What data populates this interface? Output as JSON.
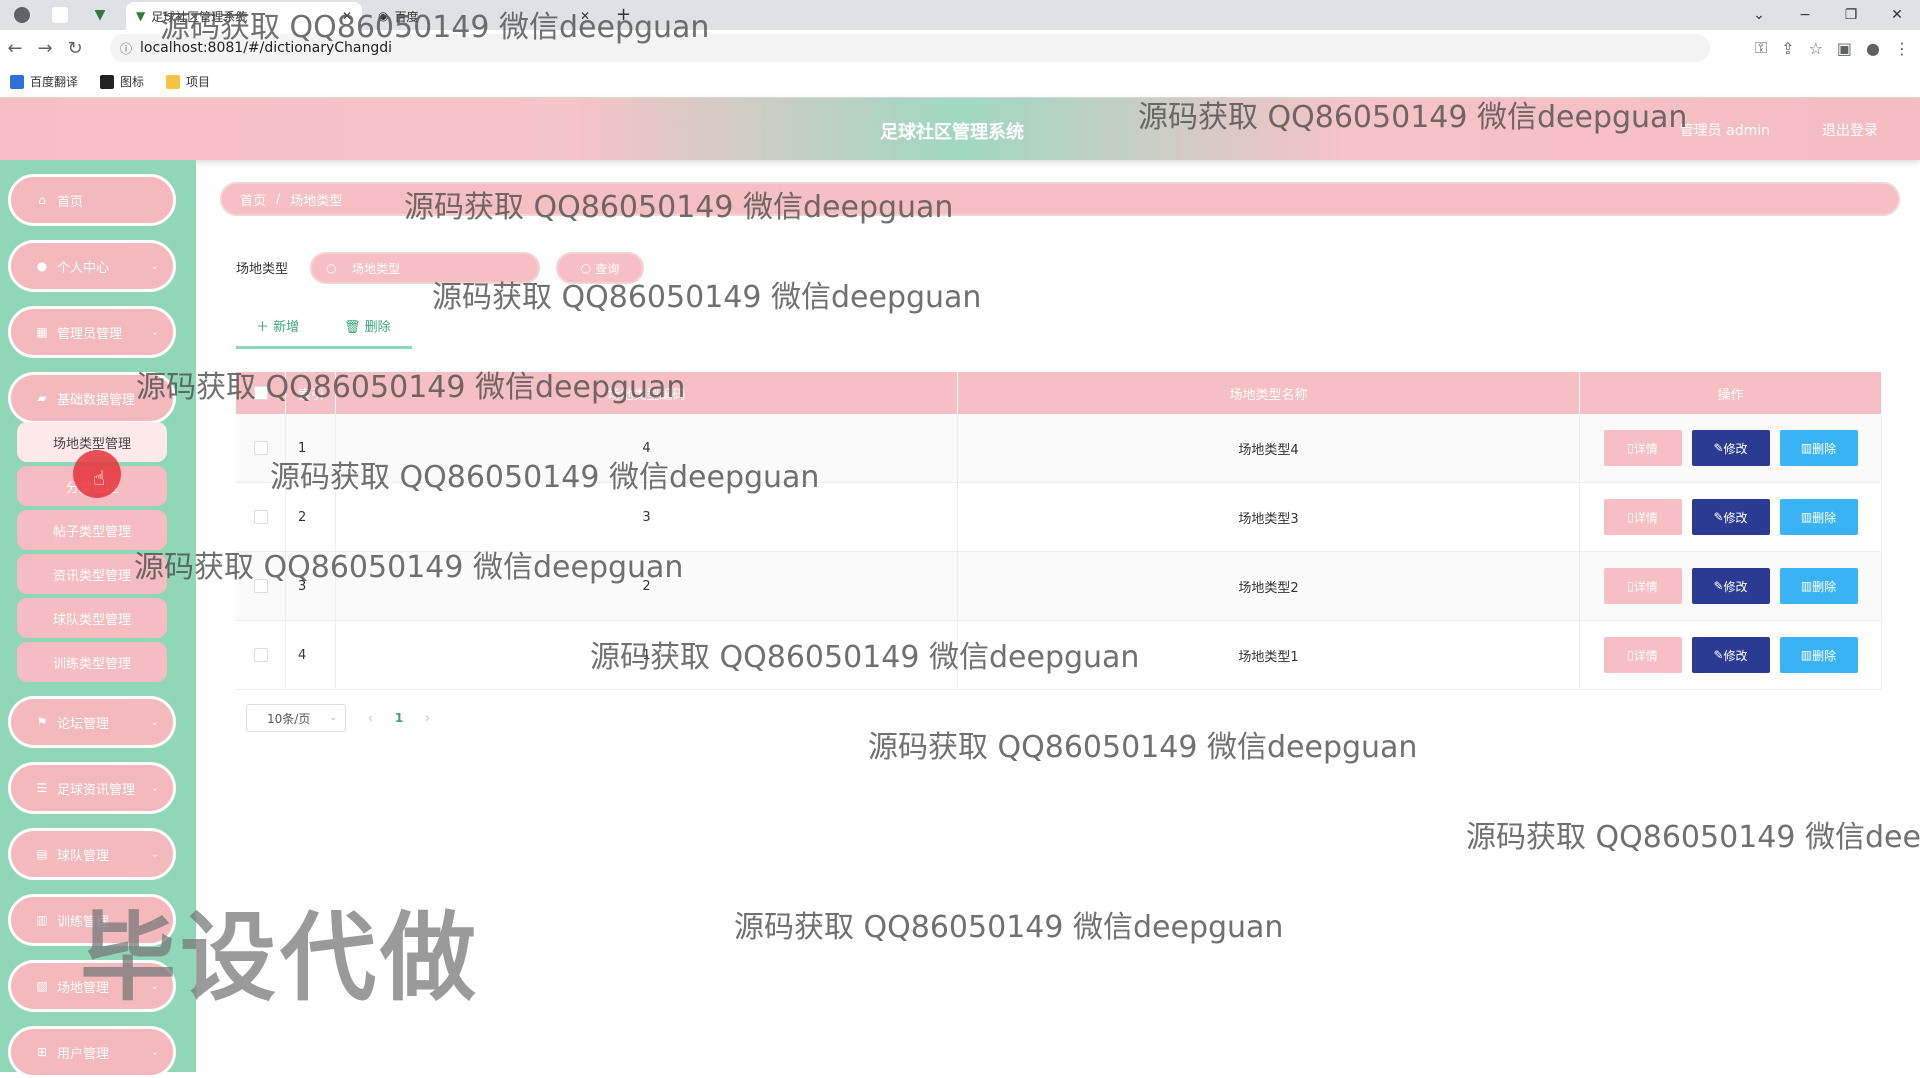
{
  "browser": {
    "tabs": [
      "足球社区管理系统",
      "百度"
    ],
    "url": "localhost:8081/#/dictionaryChangdi",
    "bookmarks": [
      "百度翻译",
      "图标",
      "项目"
    ]
  },
  "header": {
    "title": "足球社区管理系统",
    "user": "管理员 admin",
    "logout": "退出登录"
  },
  "sidebar": {
    "items": [
      {
        "label": "首页",
        "icon": "home-icon"
      },
      {
        "label": "个人中心",
        "icon": "user-icon"
      },
      {
        "label": "管理员管理",
        "icon": "admin-icon"
      },
      {
        "label": "基础数据管理",
        "icon": "data-icon"
      },
      {
        "label": "论坛管理",
        "icon": "flag-icon"
      },
      {
        "label": "足球资讯管理",
        "icon": "news-icon"
      },
      {
        "label": "球队管理",
        "icon": "team-icon"
      },
      {
        "label": "训练管理",
        "icon": "training-icon"
      },
      {
        "label": "场地管理",
        "icon": "venue-icon"
      },
      {
        "label": "用户管理",
        "icon": "users-icon"
      }
    ],
    "subitems": [
      "场地类型管理",
      "分类管理",
      "帖子类型管理",
      "资讯类型管理",
      "球队类型管理",
      "训练类型管理"
    ]
  },
  "breadcrumb": {
    "home": "首页",
    "sep": "/",
    "current": "场地类型"
  },
  "filter": {
    "label": "场地类型",
    "placeholder": "场地类型",
    "query": "查询"
  },
  "toolbar": {
    "add": "新增",
    "delete": "删除"
  },
  "table": {
    "columns": [
      "索引",
      "场地类型编码",
      "场地类型名称",
      "操作"
    ],
    "rows": [
      {
        "index": "1",
        "code": "4",
        "name": "场地类型4"
      },
      {
        "index": "2",
        "code": "3",
        "name": "场地类型3"
      },
      {
        "index": "3",
        "code": "2",
        "name": "场地类型2"
      },
      {
        "index": "4",
        "code": "1",
        "name": "场地类型1"
      }
    ],
    "actions": {
      "detail": "详情",
      "edit": "修改",
      "delete": "删除"
    }
  },
  "pagination": {
    "page_size": "10条/页",
    "current": "1"
  },
  "watermark": {
    "text": "源码获取 QQ86050149 微信deepguan",
    "big": "毕设代做"
  },
  "colors": {
    "pink": "#f6bfc3",
    "green": "#8fd7b6",
    "edit": "#2b3b93",
    "delete": "#3ab3f5"
  }
}
